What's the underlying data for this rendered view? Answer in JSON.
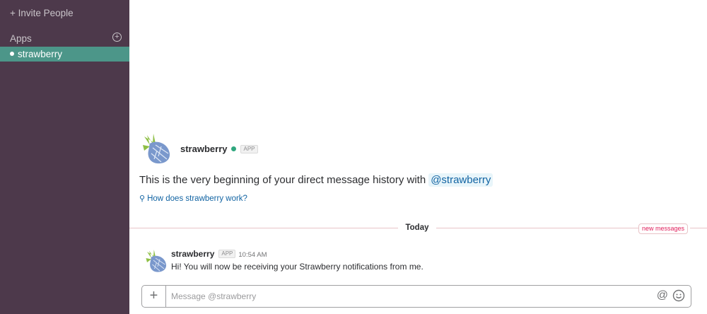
{
  "sidebar": {
    "invite_label": "+ Invite People",
    "apps_header": "Apps",
    "apps_add": "+",
    "items": [
      {
        "label": "strawberry",
        "active": true
      }
    ]
  },
  "channel": {
    "intro": {
      "name": "strawberry",
      "badge": "APP",
      "text": "This is the very beginning of your direct message history with",
      "mention": "@strawberry",
      "link": "How does strawberry work?"
    },
    "divider": {
      "day": "Today",
      "new_messages": "new messages"
    },
    "messages": [
      {
        "author": "strawberry",
        "badge": "APP",
        "time": "10:54 AM",
        "text": "Hi! You will now be receiving your Strawberry notifications from me."
      }
    ]
  },
  "composer": {
    "plus": "+",
    "placeholder": "Message @strawberry",
    "at": "@",
    "value": ""
  },
  "colors": {
    "sidebar_bg": "#4d394b",
    "sidebar_active": "#4c9689",
    "presence": "#2fa77e",
    "link": "#1264a3",
    "new_messages": "#e01e5a",
    "divider": "#e8c3c7",
    "strawberry_body": "#7a98cc",
    "strawberry_leaf": "#8ebf45"
  },
  "icons": {
    "app_avatar": "strawberry-icon",
    "hint": "lightbulb-icon",
    "emoji": "smiley-icon",
    "add_app": "plus-circle-icon"
  }
}
